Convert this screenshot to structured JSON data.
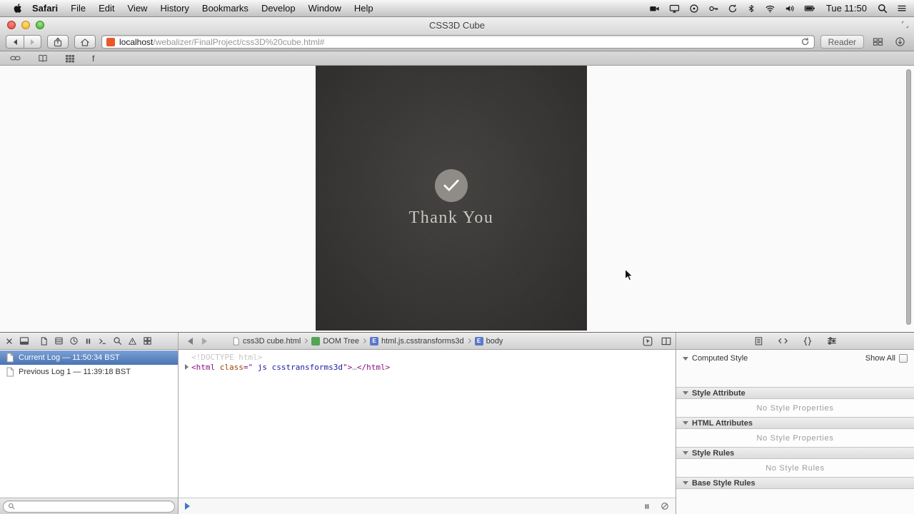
{
  "menu_bar": {
    "app_name": "Safari",
    "menus": [
      "File",
      "Edit",
      "View",
      "History",
      "Bookmarks",
      "Develop",
      "Window",
      "Help"
    ],
    "clock": "Tue 11:50"
  },
  "window": {
    "title": "CSS3D Cube"
  },
  "toolbar": {
    "url_host": "localhost",
    "url_path": "/webalizer/FinalProject/css3D%20cube.html#",
    "reader_label": "Reader"
  },
  "bookmarks_bar": {
    "favorite_label": "f"
  },
  "page": {
    "message": "Thank You"
  },
  "inspector": {
    "logs": [
      {
        "label": "Current Log — 11:50:34 BST"
      },
      {
        "label": "Previous Log 1 — 11:39:18 BST"
      }
    ],
    "breadcrumbs": [
      {
        "label": "css3D cube.html"
      },
      {
        "label": "DOM Tree"
      },
      {
        "label": "html.js.csstransforms3d",
        "badge": "E"
      },
      {
        "label": "body",
        "badge": "E"
      }
    ],
    "dom": {
      "doctype": "<!DOCTYPE html>",
      "open_tag": "<html ",
      "attr_name": "class",
      "eq": "=\"",
      "attr_value": " js csstransforms3d",
      "close_bracket": "\">",
      "ellipsis": "…",
      "close_tag": "</html>"
    },
    "style_panel": {
      "computed_label": "Computed Style",
      "show_all_label": "Show All",
      "sections": [
        {
          "title": "Style Attribute",
          "empty": "No Style Properties"
        },
        {
          "title": "HTML Attributes",
          "empty": "No Style Properties"
        },
        {
          "title": "Style Rules",
          "empty": "No Style Rules"
        },
        {
          "title": "Base Style Rules"
        }
      ]
    }
  },
  "colors": {
    "selection_blue": "#4a74b2",
    "dark_panel": "#3b3937",
    "syntax_tag": "#881280",
    "syntax_attr_name": "#994500",
    "syntax_attr_value": "#1a1aa6",
    "favicon_orange": "#e8592a"
  }
}
